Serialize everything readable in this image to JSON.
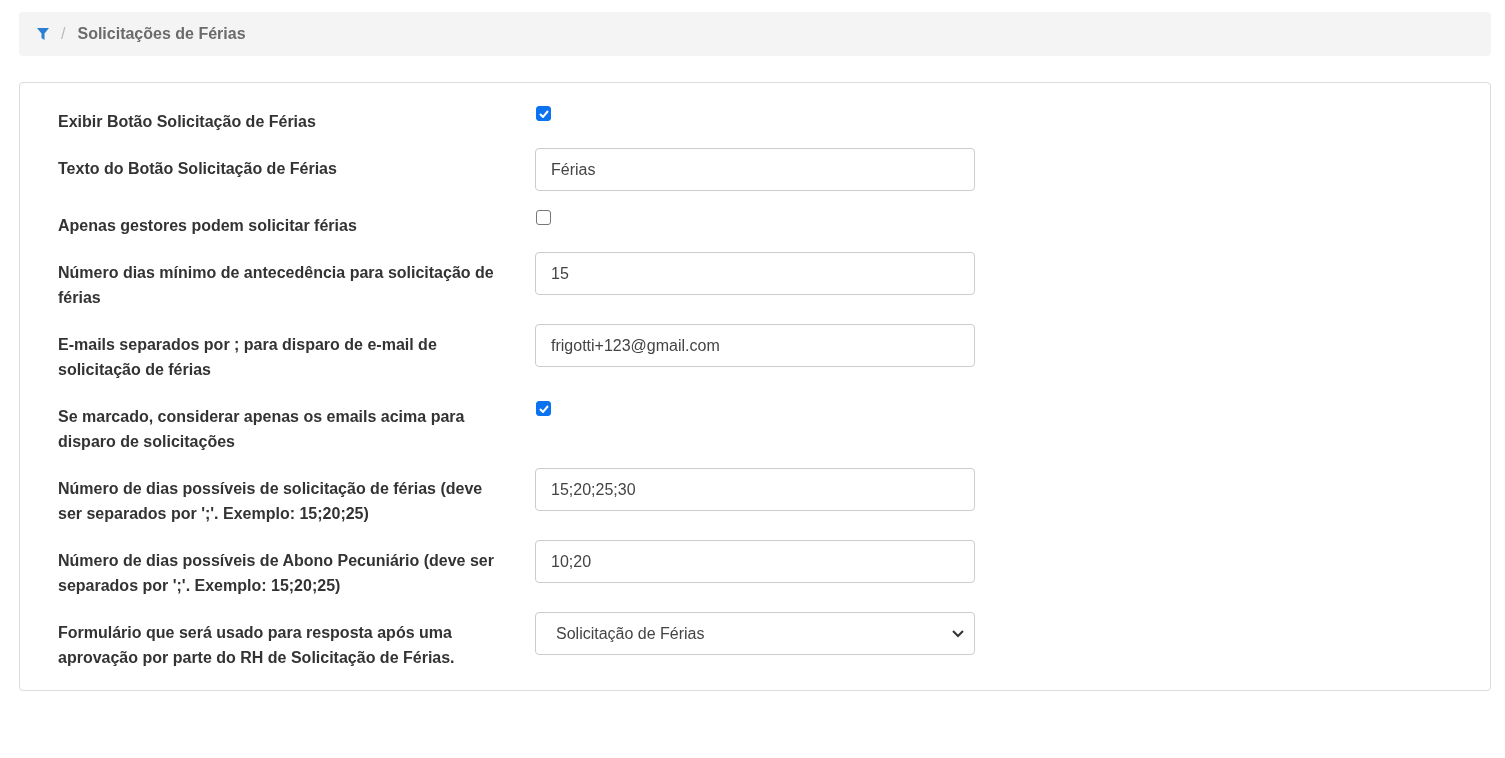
{
  "breadcrumb": {
    "separator": "/",
    "current": "Solicitações de Férias"
  },
  "fields": [
    {
      "kind": "checkbox",
      "label": "Exibir Botão Solicitação de Férias",
      "checked": true
    },
    {
      "kind": "text",
      "label": "Texto do Botão Solicitação de Férias",
      "value": "Férias"
    },
    {
      "kind": "checkbox",
      "label": "Apenas gestores podem solicitar férias",
      "checked": false
    },
    {
      "kind": "text",
      "label": "Número dias mínimo de antecedência para solicitação de férias",
      "value": "15"
    },
    {
      "kind": "text",
      "label": "E-mails separados por ; para disparo de e-mail de solicitação de férias",
      "value": "frigotti+123@gmail.com"
    },
    {
      "kind": "checkbox",
      "label": "Se marcado, considerar apenas os emails acima para disparo de solicitações",
      "checked": true
    },
    {
      "kind": "text",
      "label": "Número de dias possíveis de solicitação de férias (deve ser separados por ';'. Exemplo: 15;20;25)",
      "value": "15;20;25;30"
    },
    {
      "kind": "text",
      "label": "Número de dias possíveis de Abono Pecuniário (deve ser separados por ';'. Exemplo: 15;20;25)",
      "value": "10;20"
    },
    {
      "kind": "select",
      "label": "Formulário que será usado para resposta após uma aprovação por parte do RH de Solicitação de Férias.",
      "value": "Solicitação de Férias"
    }
  ]
}
